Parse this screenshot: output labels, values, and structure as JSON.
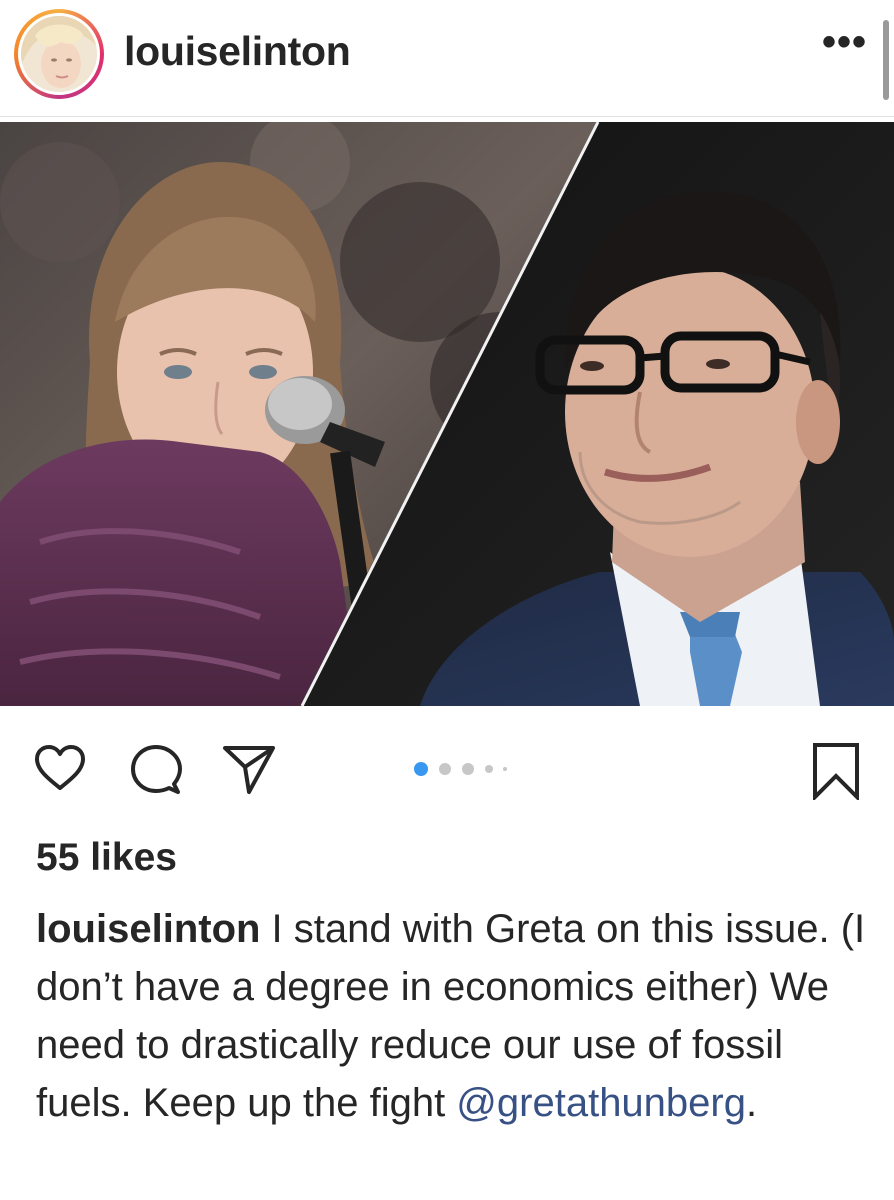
{
  "post": {
    "username": "louiselinton",
    "more_label": "•••",
    "likes": "55 likes",
    "caption_user": "louiselinton",
    "caption_text": " I stand with Greta on this issue. (I don’t have a degree in economics either) We need to drastically reduce our use of fossil fuels. Keep up the fight ",
    "mention": "@gretathunberg",
    "caption_end": "."
  },
  "carousel": {
    "total": 5,
    "active_index": 0
  },
  "icons": {
    "like": "heart-icon",
    "comment": "comment-icon",
    "share": "send-icon",
    "save": "bookmark-icon"
  },
  "colors": {
    "accent": "#3897f0",
    "mention": "#385185",
    "text": "#262626"
  }
}
